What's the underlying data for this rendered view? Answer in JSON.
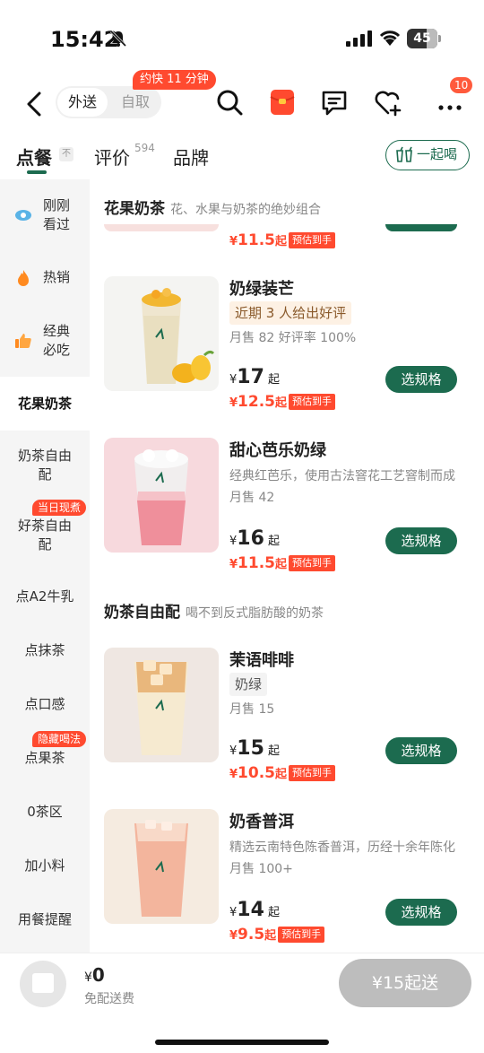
{
  "status_bar": {
    "time": "15:42",
    "battery": "45"
  },
  "header": {
    "modes": [
      "外送",
      "自取"
    ],
    "eta_badge": "约快 11 分钟",
    "message_count": "10"
  },
  "tabs": [
    {
      "label": "点餐"
    },
    {
      "label": "评价",
      "count": "594"
    },
    {
      "label": "品牌"
    }
  ],
  "fold_mark": "不",
  "drink_together": "一起喝",
  "sidebar": {
    "items": [
      {
        "label_lines": [
          "刚刚",
          "看过"
        ]
      },
      {
        "label_lines": [
          "热销"
        ]
      },
      {
        "label_lines": [
          "经典",
          "必吃"
        ]
      },
      {
        "label": "花果奶茶"
      },
      {
        "label": "奶茶自由配"
      },
      {
        "label": "好茶自由配",
        "tag": "当日现煮"
      },
      {
        "label": "点A2牛乳"
      },
      {
        "label": "点抹茶"
      },
      {
        "label": "点口感"
      },
      {
        "label": "点果茶",
        "tag": "隐藏喝法"
      },
      {
        "label": "0茶区"
      },
      {
        "label": "加小料"
      },
      {
        "label": "用餐提醒"
      }
    ]
  },
  "sections": [
    {
      "name": "花果奶茶",
      "desc": "花、水果与奶茶的绝妙组合"
    },
    {
      "name": "奶茶自由配",
      "desc": "喝不到反式脂肪酸的奶茶"
    }
  ],
  "prev_item_estimate": "11.5",
  "products": [
    {
      "name": "奶绿装芒",
      "highlight": "近期 3 人给出好评",
      "sales": "月售 82  好评率 100%",
      "price": "17",
      "estimate": "12.5"
    },
    {
      "name": "甜心芭乐奶绿",
      "desc": "经典红芭乐，使用古法窨花工艺窨制而成",
      "sales": "月售 42",
      "price": "16",
      "estimate": "11.5"
    },
    {
      "name": "茉语啡啡",
      "tag": "奶绿",
      "sales": "月售 15",
      "price": "15",
      "estimate": "10.5"
    },
    {
      "name": "奶香普洱",
      "desc": "精选云南特色陈香普洱，历经十余年陈化",
      "sales": "月售 100+",
      "price": "14",
      "estimate": "9.5"
    }
  ],
  "labels": {
    "yen": "¥",
    "qi": "起",
    "estimate_tag": "预估到手",
    "spec_button": "选规格"
  },
  "bottom_bar": {
    "total": "0",
    "delivery_fee": "免配送费",
    "min_order": "¥15起送"
  },
  "colors": {
    "brand_green": "#1c6b4f",
    "promo_red": "#ff4a2f",
    "sidebar_bg": "#f5f5f5"
  }
}
